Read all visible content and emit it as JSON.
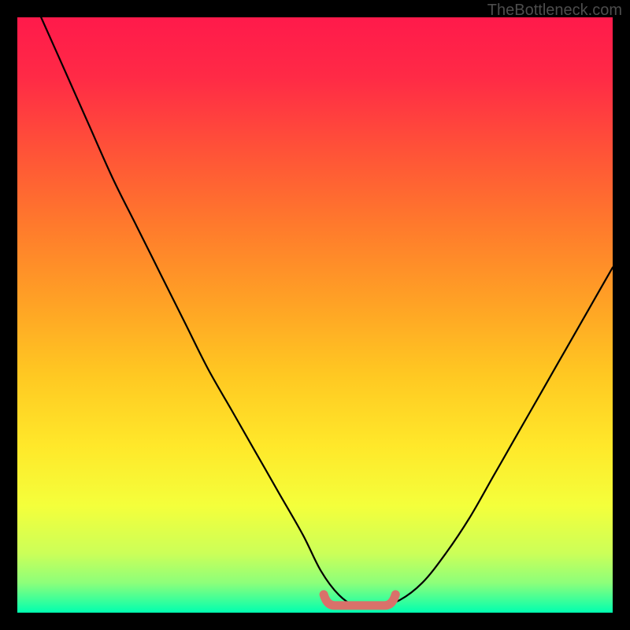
{
  "watermark": "TheBottleneck.com",
  "colors": {
    "frame": "#000000",
    "gradient_stops": [
      {
        "offset": 0.0,
        "color": "#ff1a4b"
      },
      {
        "offset": 0.1,
        "color": "#ff2a46"
      },
      {
        "offset": 0.22,
        "color": "#ff5138"
      },
      {
        "offset": 0.35,
        "color": "#ff7a2c"
      },
      {
        "offset": 0.48,
        "color": "#ffa225"
      },
      {
        "offset": 0.6,
        "color": "#ffc822"
      },
      {
        "offset": 0.72,
        "color": "#ffe82a"
      },
      {
        "offset": 0.82,
        "color": "#f4ff3b"
      },
      {
        "offset": 0.9,
        "color": "#ccff58"
      },
      {
        "offset": 0.95,
        "color": "#8dff7a"
      },
      {
        "offset": 0.985,
        "color": "#2bffa0"
      },
      {
        "offset": 1.0,
        "color": "#00ffb0"
      }
    ],
    "curve": "#000000",
    "flat_marker": "#d9716a"
  },
  "chart_data": {
    "type": "line",
    "title": "",
    "xlabel": "",
    "ylabel": "",
    "xlim": [
      0,
      100
    ],
    "ylim": [
      0,
      100
    ],
    "grid": false,
    "series": [
      {
        "name": "bottleneck-curve",
        "x": [
          4,
          8,
          12,
          16,
          20,
          24,
          28,
          32,
          36,
          40,
          44,
          48,
          51,
          54,
          57,
          60,
          64,
          68,
          72,
          76,
          80,
          84,
          88,
          92,
          96,
          100
        ],
        "y": [
          100,
          91,
          82,
          73,
          65,
          57,
          49,
          41,
          34,
          27,
          20,
          13,
          7,
          3,
          1,
          1,
          2,
          5,
          10,
          16,
          23,
          30,
          37,
          44,
          51,
          58
        ]
      }
    ],
    "flat_region": {
      "x_start": 52,
      "x_end": 63,
      "y": 1.2
    }
  }
}
